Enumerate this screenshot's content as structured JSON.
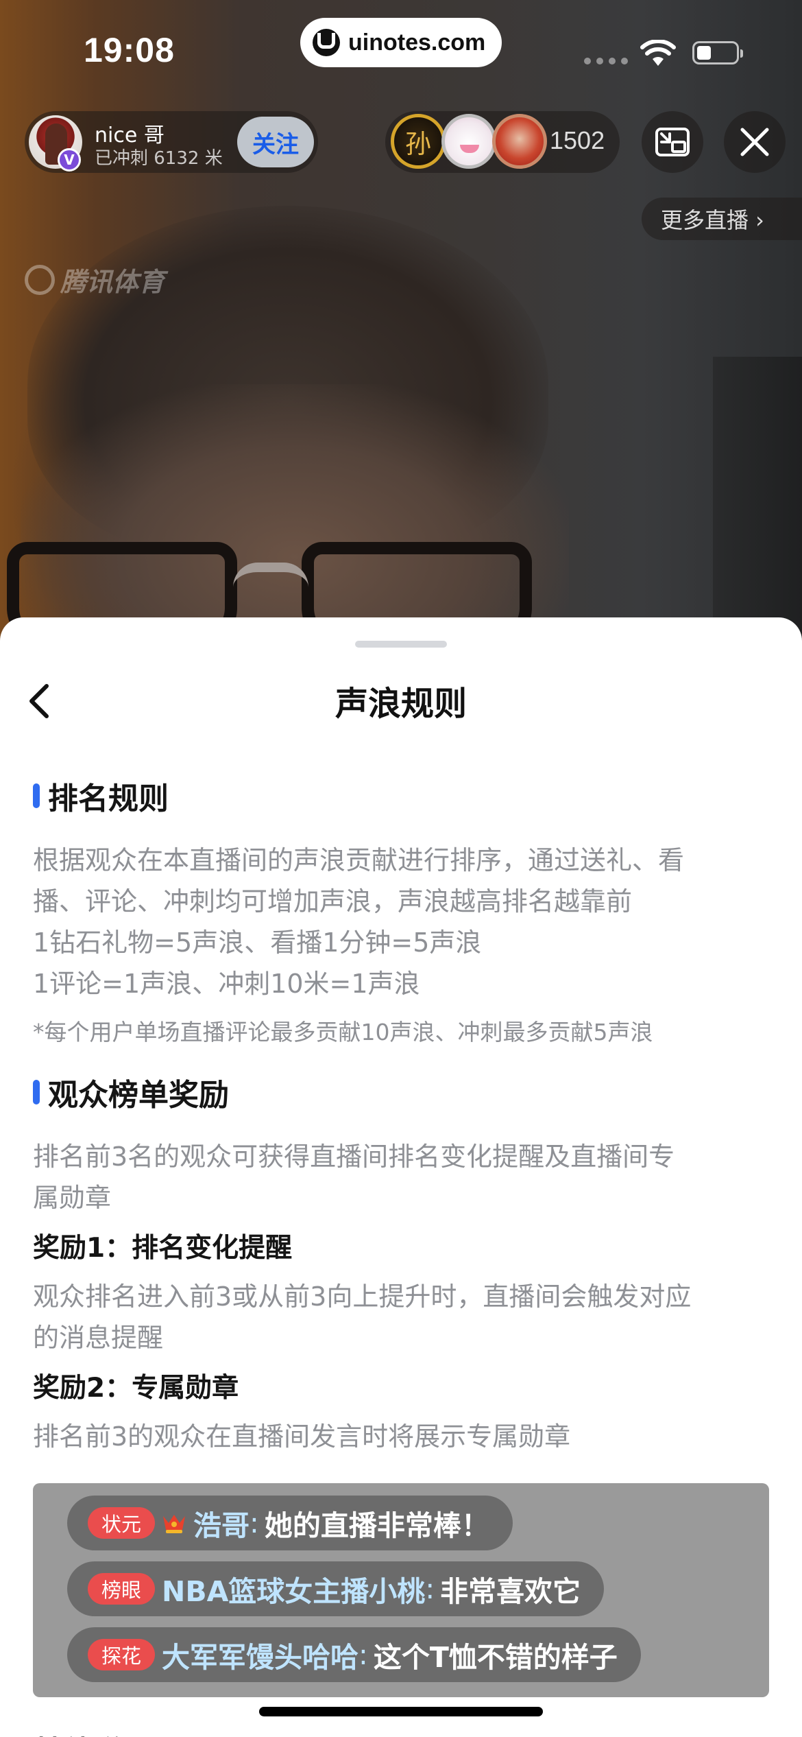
{
  "status_bar": {
    "time": "19:08",
    "url": "uinotes.com"
  },
  "host": {
    "name": "nice 哥",
    "sub": "已冲刺 6132 米",
    "follow_label": "关注"
  },
  "viewers": {
    "count": "1502",
    "first_avatar_glyph": "孙"
  },
  "more_live_label": "更多直播 ›",
  "watermark": "腾讯体育",
  "sheet": {
    "title": "声浪规则",
    "ranking": {
      "heading": "排名规则",
      "lines": [
        "根据观众在本直播间的声浪贡献进行排序，通过送礼、看",
        "播、评论、冲刺均可增加声浪，声浪越高排名越靠前",
        "1钻石礼物=5声浪、看播1分钟=5声浪",
        "1评论=1声浪、冲刺10米=1声浪"
      ],
      "note": "*每个用户单场直播评论最多贡献10声浪、冲刺最多贡献5声浪"
    },
    "rewards": {
      "heading": "观众榜单奖励",
      "intro_lines": [
        "排名前3名的观众可获得直播间排名变化提醒及直播间专",
        "属勋章"
      ],
      "reward1_title": "奖励1：排名变化提醒",
      "reward1_lines": [
        "观众排名进入前3或从前3向上提升时，直播间会触发对应",
        "的消息提醒"
      ],
      "reward2_title": "奖励2：专属勋章",
      "reward2_text": "排名前3的观众在直播间发言时将展示专属勋章"
    },
    "examples": [
      {
        "badge": "状元",
        "user": "浩哥",
        "colon": ":",
        "message": "她的直播非常棒！"
      },
      {
        "badge": "榜眼",
        "user": "NBA篮球女主播小桃",
        "colon": ":",
        "message": "非常喜欢它"
      },
      {
        "badge": "探花",
        "user": "大军军馒头哈哈",
        "colon": ":",
        "message": "这个T恤不错的样子"
      }
    ],
    "next_heading": "其他说明"
  },
  "colors": {
    "accent": "#2f6cf0",
    "badge_red": "#ea4d4d",
    "follow_text": "#1a5de8"
  },
  "icons": [
    "wifi-icon",
    "battery-icon",
    "pip-icon",
    "close-icon",
    "back-chevron-icon",
    "crown-icon"
  ]
}
